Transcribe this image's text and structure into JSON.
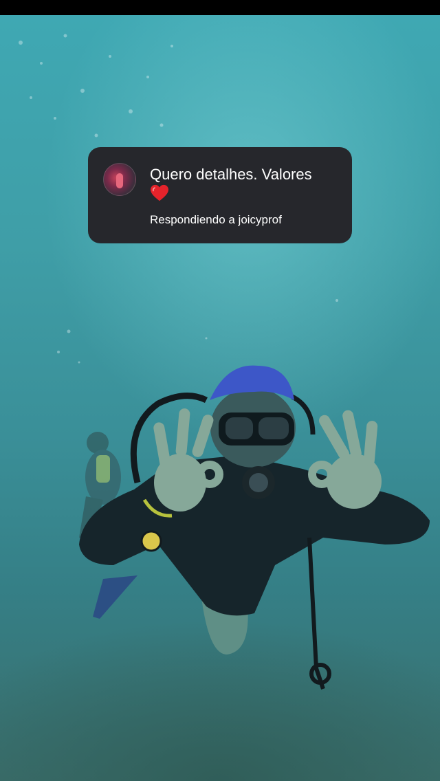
{
  "reply": {
    "message": "Quero detalhes.  Valores",
    "emoji_icon": "red-heart-icon",
    "context": "Respondiendo a joicyprof"
  },
  "colors": {
    "water": "#3f9ea7",
    "sticker_bg": "#26272c",
    "heart": "#e5232b"
  }
}
